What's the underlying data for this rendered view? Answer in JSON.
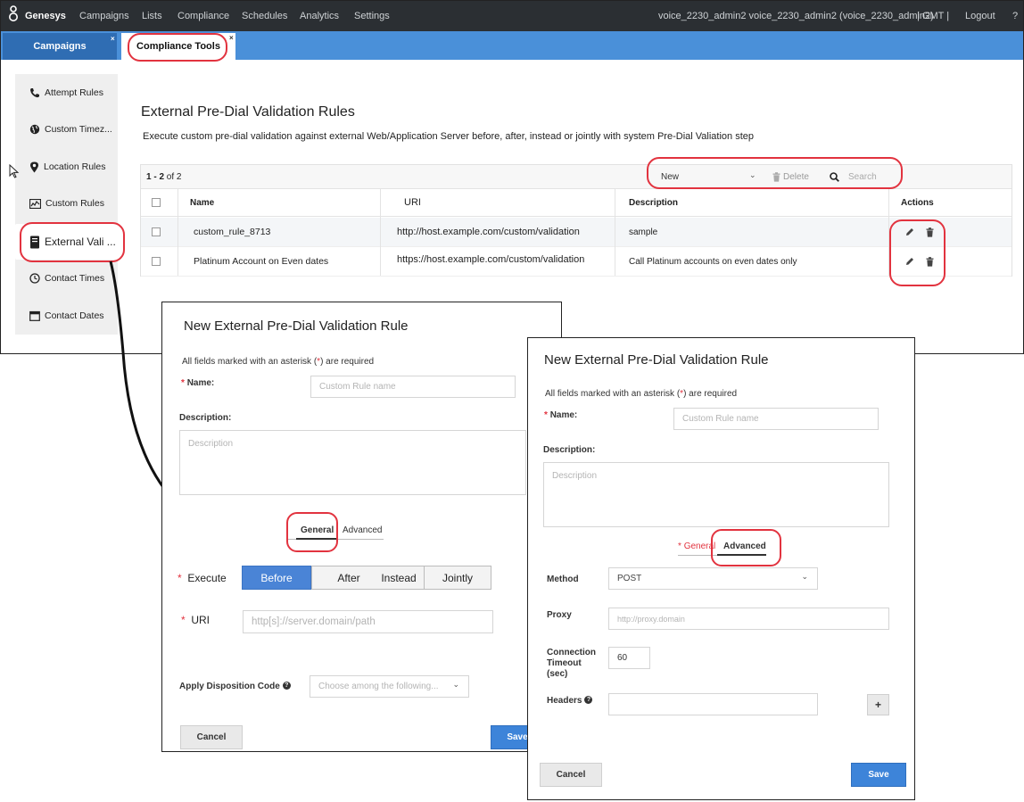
{
  "topbar": {
    "brand": "Genesys",
    "nav": [
      "Campaigns",
      "Lists",
      "Compliance",
      "Schedules",
      "Analytics",
      "Settings"
    ],
    "user": "voice_2230_admin2 voice_2230_admin2 (voice_2230_admin2)",
    "timezone": "| GMT |",
    "logout": "Logout",
    "help": "?"
  },
  "tabs": {
    "campaigns": "Campaigns",
    "compliance": "Compliance Tools",
    "close": "×"
  },
  "sidebar": {
    "items": [
      {
        "label": "Attempt Rules",
        "icon": "phone-icon"
      },
      {
        "label": "Custom Timez...",
        "icon": "globe-icon"
      },
      {
        "label": "Location Rules",
        "icon": "location-pin-icon"
      },
      {
        "label": "Custom Rules",
        "icon": "chart-icon"
      },
      {
        "label": "External Vali ...",
        "icon": "server-icon"
      },
      {
        "label": "Contact Times",
        "icon": "clock-icon"
      },
      {
        "label": "Contact Dates",
        "icon": "calendar-icon"
      }
    ]
  },
  "main": {
    "title": "External Pre-Dial Validation Rules",
    "subtitle": "Execute custom pre-dial validation against external Web/Application Server before, after, instead or jointly with system Pre-Dial Valiation step",
    "count_range": "1 - 2",
    "count_of": "of 2",
    "new_label": "New",
    "delete_label": "Delete",
    "search_placeholder": "Search",
    "columns": {
      "name": "Name",
      "uri": "URI",
      "description": "Description",
      "actions": "Actions"
    },
    "rows": [
      {
        "name": "custom_rule_8713",
        "uri": "http://host.example.com/custom/validation",
        "description": "sample"
      },
      {
        "name": "Platinum Account on Even dates",
        "uri": "https://host.example.com/custom/validation",
        "description": "Call Platinum accounts on even dates only"
      }
    ]
  },
  "dialog_general": {
    "title": "New External Pre-Dial Validation Rule",
    "note_before": "All fields marked with an asterisk (",
    "note_star": "*",
    "note_after": ") are required",
    "name_label": "Name:",
    "name_placeholder": "Custom Rule name",
    "description_label": "Description:",
    "description_placeholder": "Description",
    "tab_general": "General",
    "tab_advanced": "Advanced",
    "execute_label": "Execute",
    "execute_options": [
      "Before",
      "After",
      "Instead",
      "Jointly"
    ],
    "execute_selected": "Before",
    "uri_label": "URI",
    "uri_placeholder": "http[s]://server.domain/path",
    "disposition_label": "Apply Disposition Code",
    "disposition_placeholder": "Choose among the following...",
    "cancel": "Cancel",
    "save": "Save"
  },
  "dialog_advanced": {
    "title": "New External Pre-Dial Validation Rule",
    "note_before": "All fields marked with an asterisk (",
    "note_star": "*",
    "note_after": ") are required",
    "name_label": "Name:",
    "name_placeholder": "Custom Rule name",
    "description_label": "Description:",
    "description_placeholder": "Description",
    "tab_general": "General",
    "tab_advanced": "Advanced",
    "method_label": "Method",
    "method_value": "POST",
    "proxy_label": "Proxy",
    "proxy_placeholder": "http://proxy.domain",
    "timeout_label_1": "Connection",
    "timeout_label_2": "Timeout",
    "timeout_label_3": "(sec)",
    "timeout_value": "60",
    "headers_label": "Headers",
    "add": "+",
    "cancel": "Cancel",
    "save": "Save"
  },
  "colors": {
    "topbar": "#2b2f33",
    "tabstrip": "#4a90d9",
    "highlight": "#e2333f",
    "primary": "#3d84d9"
  }
}
